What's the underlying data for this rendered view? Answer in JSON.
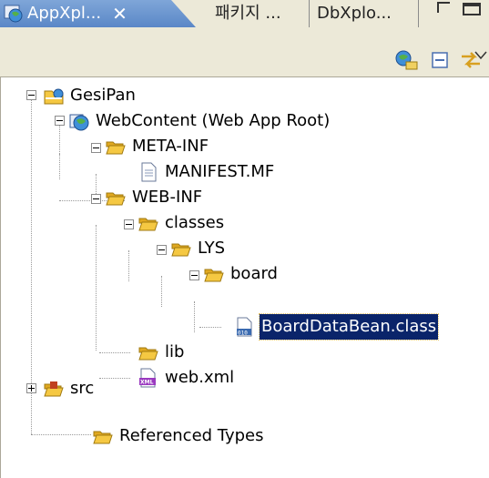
{
  "tabs": [
    {
      "label": "AppXpl...",
      "close": "✕",
      "active": true,
      "icon": "web-app-globe-icon"
    },
    {
      "label": "패키지 ...",
      "active": false
    },
    {
      "label": "DbXplo...",
      "active": false
    }
  ],
  "window_controls": {
    "minimize": "minimize-icon",
    "maximize": "maximize-icon"
  },
  "toolbar": {
    "buttons": [
      "link-with-editor-icon",
      "collapse-all-icon",
      "sync-icon",
      "view-menu-icon"
    ]
  },
  "tree": {
    "nodes": [
      {
        "label": "GesiPan",
        "icon": "project-icon",
        "expanded": true
      },
      {
        "label": "WebContent (Web App Root)",
        "icon": "web-root-icon",
        "expanded": true
      },
      {
        "label": "META-INF",
        "icon": "folder-icon",
        "expanded": true
      },
      {
        "label": "MANIFEST.MF",
        "icon": "text-file-icon"
      },
      {
        "label": "WEB-INF",
        "icon": "folder-icon",
        "expanded": true
      },
      {
        "label": "classes",
        "icon": "folder-icon",
        "expanded": true
      },
      {
        "label": "LYS",
        "icon": "folder-icon",
        "expanded": true
      },
      {
        "label": "board",
        "icon": "folder-icon",
        "expanded": true
      },
      {
        "label": "BoardDataBean.class",
        "icon": "class-file-icon",
        "selected": true
      },
      {
        "label": "lib",
        "icon": "folder-icon"
      },
      {
        "label": "web.xml",
        "icon": "xml-file-icon"
      },
      {
        "label": "src",
        "icon": "source-folder-icon",
        "expanded": false
      },
      {
        "label": "Referenced Types",
        "icon": "folder-icon"
      }
    ]
  },
  "colors": {
    "active_tab": "#6d95cf",
    "selection": "#0a246a",
    "chrome": "#ece9d8",
    "folder": "#f5c842"
  }
}
